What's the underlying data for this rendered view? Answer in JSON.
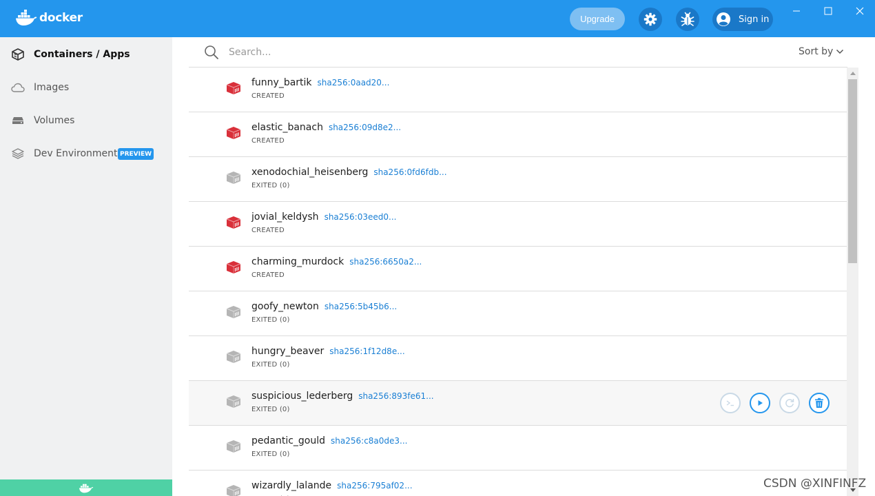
{
  "app": {
    "name": "docker",
    "brand_color": "#2496ed",
    "accent_green": "#4fd1a5"
  },
  "header": {
    "upgrade_label": "Upgrade",
    "settings_icon": "gear-icon",
    "troubleshoot_icon": "bug-icon",
    "signin_label": "Sign in"
  },
  "sidebar": {
    "items": [
      {
        "label": "Containers / Apps",
        "icon": "container-stack-icon",
        "active": true
      },
      {
        "label": "Images",
        "icon": "cloud-icon",
        "active": false
      },
      {
        "label": "Volumes",
        "icon": "disk-icon",
        "active": false
      },
      {
        "label": "Dev Environments",
        "icon": "layers-icon",
        "active": false,
        "badge": "PREVIEW"
      }
    ]
  },
  "search": {
    "placeholder": "Search...",
    "value": ""
  },
  "sort": {
    "label": "Sort by"
  },
  "containers": [
    {
      "name": "funny_bartik",
      "sha": "sha256:0aad20...",
      "status": "CREATED",
      "state": "created"
    },
    {
      "name": "elastic_banach",
      "sha": "sha256:09d8e2...",
      "status": "CREATED",
      "state": "created"
    },
    {
      "name": "xenodochial_heisenberg",
      "sha": "sha256:0fd6fdb...",
      "status": "EXITED (0)",
      "state": "exited"
    },
    {
      "name": "jovial_keldysh",
      "sha": "sha256:03eed0...",
      "status": "CREATED",
      "state": "created"
    },
    {
      "name": "charming_murdock",
      "sha": "sha256:6650a2...",
      "status": "CREATED",
      "state": "created"
    },
    {
      "name": "goofy_newton",
      "sha": "sha256:5b45b6...",
      "status": "EXITED (0)",
      "state": "exited"
    },
    {
      "name": "hungry_beaver",
      "sha": "sha256:1f12d8e...",
      "status": "EXITED (0)",
      "state": "exited"
    },
    {
      "name": "suspicious_lederberg",
      "sha": "sha256:893fe61...",
      "status": "EXITED (0)",
      "state": "exited",
      "hovered": true
    },
    {
      "name": "pedantic_gould",
      "sha": "sha256:c8a0de3...",
      "status": "EXITED (0)",
      "state": "exited"
    },
    {
      "name": "wizardly_lalande",
      "sha": "sha256:795af02...",
      "status": "EXITED (0)",
      "state": "exited"
    }
  ],
  "row_actions": [
    {
      "name": "cli-button",
      "icon": "terminal-icon",
      "enabled": false
    },
    {
      "name": "start-button",
      "icon": "play-icon",
      "enabled": true
    },
    {
      "name": "restart-button",
      "icon": "restart-icon",
      "enabled": false
    },
    {
      "name": "delete-button",
      "icon": "trash-icon",
      "enabled": true
    }
  ],
  "status_colors": {
    "created": "#d9303a",
    "exited": "#b5b5b5"
  },
  "watermark": "CSDN @XINFINFZ"
}
